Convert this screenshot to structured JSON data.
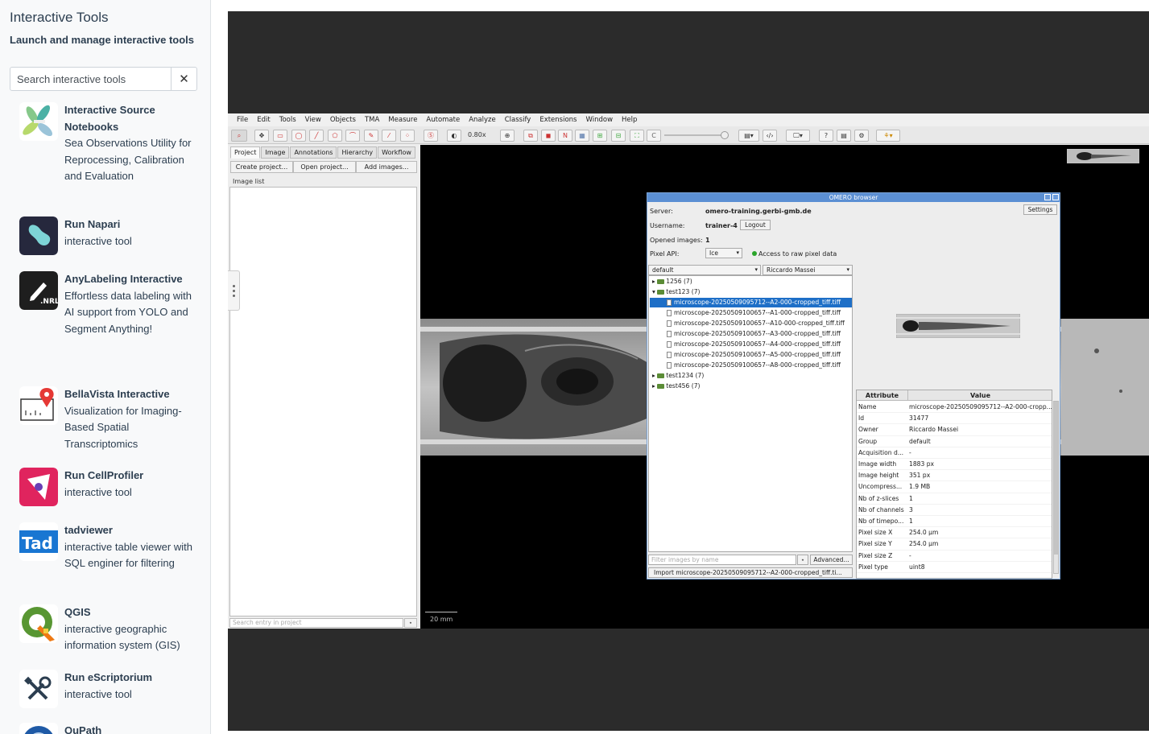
{
  "sidebar": {
    "title": "Interactive Tools",
    "subtitle": "Launch and manage interactive tools",
    "search": {
      "placeholder": "Search interactive tools",
      "value": ""
    },
    "clear_label": "✕",
    "tools": [
      {
        "name": "Interactive Source Notebooks",
        "desc": "Sea Observations Utility for Reprocessing, Calibration and Evaluation",
        "icon": "leaf-logo-icon"
      },
      {
        "name": "Run Napari",
        "desc": "interactive tool",
        "icon": "napari-icon"
      },
      {
        "name": "AnyLabeling Interactive",
        "desc": "Effortless data labeling with AI support from YOLO and Segment Anything!",
        "icon": "pen-nrl-icon"
      },
      {
        "name": "BellaVista Interactive",
        "desc": "Visualization for Imaging-Based Spatial Transcriptomics",
        "icon": "map-pin-icon"
      },
      {
        "name": "Run CellProfiler",
        "desc": "interactive tool",
        "icon": "cellprofiler-icon"
      },
      {
        "name": "tadviewer",
        "desc": "interactive table viewer with SQL enginer for filtering",
        "icon": "tad-icon"
      },
      {
        "name": "QGIS",
        "desc": "interactive geographic information system (GIS)",
        "icon": "qgis-icon"
      },
      {
        "name": "Run eScriptorium",
        "desc": "interactive tool",
        "icon": "tools-icon"
      },
      {
        "name": "QuPath",
        "desc": "",
        "icon": "qupath-icon"
      }
    ]
  },
  "qupath": {
    "menu": [
      "File",
      "Edit",
      "Tools",
      "View",
      "Objects",
      "TMA",
      "Measure",
      "Automate",
      "Analyze",
      "Classify",
      "Extensions",
      "Window",
      "Help"
    ],
    "zoom": "0.80x",
    "toolbar_letters": {
      "n": "N",
      "c": "C"
    },
    "tabs": [
      "Project",
      "Image",
      "Annotations",
      "Hierarchy",
      "Workflow"
    ],
    "project_buttons": [
      "Create project...",
      "Open project...",
      "Add images..."
    ],
    "image_list_label": "Image list",
    "search_entry_placeholder": "Search entry in project",
    "scale_label": "20 mm"
  },
  "omero": {
    "title": "OMERO browser",
    "server_label": "Server:",
    "server": "omero-training.gerbi-gmb.de",
    "settings_label": "Settings",
    "username_label": "Username:",
    "username": "trainer-4",
    "logout_label": "Logout",
    "opened_label": "Opened images:",
    "opened": "1",
    "pixel_api_label": "Pixel API:",
    "pixel_api": "Ice",
    "access_label": "Access to raw pixel data",
    "group_select": "default",
    "owner_select": "Riccardo Massei",
    "tree": [
      {
        "label": "1256 (7)",
        "type": "folder",
        "expanded": false
      },
      {
        "label": "test123 (7)",
        "type": "folder",
        "expanded": true
      },
      {
        "label": "microscope-20250509095712--A2-000-cropped_tiff.tiff",
        "type": "file",
        "selected": true
      },
      {
        "label": "microscope-20250509100657--A1-000-cropped_tiff.tiff",
        "type": "file"
      },
      {
        "label": "microscope-20250509100657--A10-000-cropped_tiff.tiff",
        "type": "file"
      },
      {
        "label": "microscope-20250509100657--A3-000-cropped_tiff.tiff",
        "type": "file"
      },
      {
        "label": "microscope-20250509100657--A4-000-cropped_tiff.tiff",
        "type": "file"
      },
      {
        "label": "microscope-20250509100657--A5-000-cropped_tiff.tiff",
        "type": "file"
      },
      {
        "label": "microscope-20250509100657--A8-000-cropped_tiff.tiff",
        "type": "file"
      },
      {
        "label": "test1234 (7)",
        "type": "folder",
        "expanded": false
      },
      {
        "label": "test456 (7)",
        "type": "folder",
        "expanded": false
      }
    ],
    "filter_placeholder": "Filter images by name",
    "filter_btn": "⋆",
    "advanced_label": "Advanced...",
    "import_label": "Import microscope-20250509095712--A2-000-cropped_tiff.ti...",
    "table_headers": [
      "Attribute",
      "Value"
    ],
    "attributes": [
      [
        "Name",
        "microscope-20250509095712--A2-000-cropp..."
      ],
      [
        "Id",
        "31477"
      ],
      [
        "Owner",
        "Riccardo Massei"
      ],
      [
        "Group",
        "default"
      ],
      [
        "Acquisition d...",
        "-"
      ],
      [
        "Image width",
        "1883 px"
      ],
      [
        "Image height",
        "351 px"
      ],
      [
        "Uncompress...",
        "1.9 MB"
      ],
      [
        "Nb of z-slices",
        "1"
      ],
      [
        "Nb of channels",
        "3"
      ],
      [
        "Nb of timepo...",
        "1"
      ],
      [
        "Pixel size X",
        "254.0 µm"
      ],
      [
        "Pixel size Y",
        "254.0 µm"
      ],
      [
        "Pixel size Z",
        "-"
      ],
      [
        "Pixel type",
        "uint8"
      ]
    ]
  }
}
